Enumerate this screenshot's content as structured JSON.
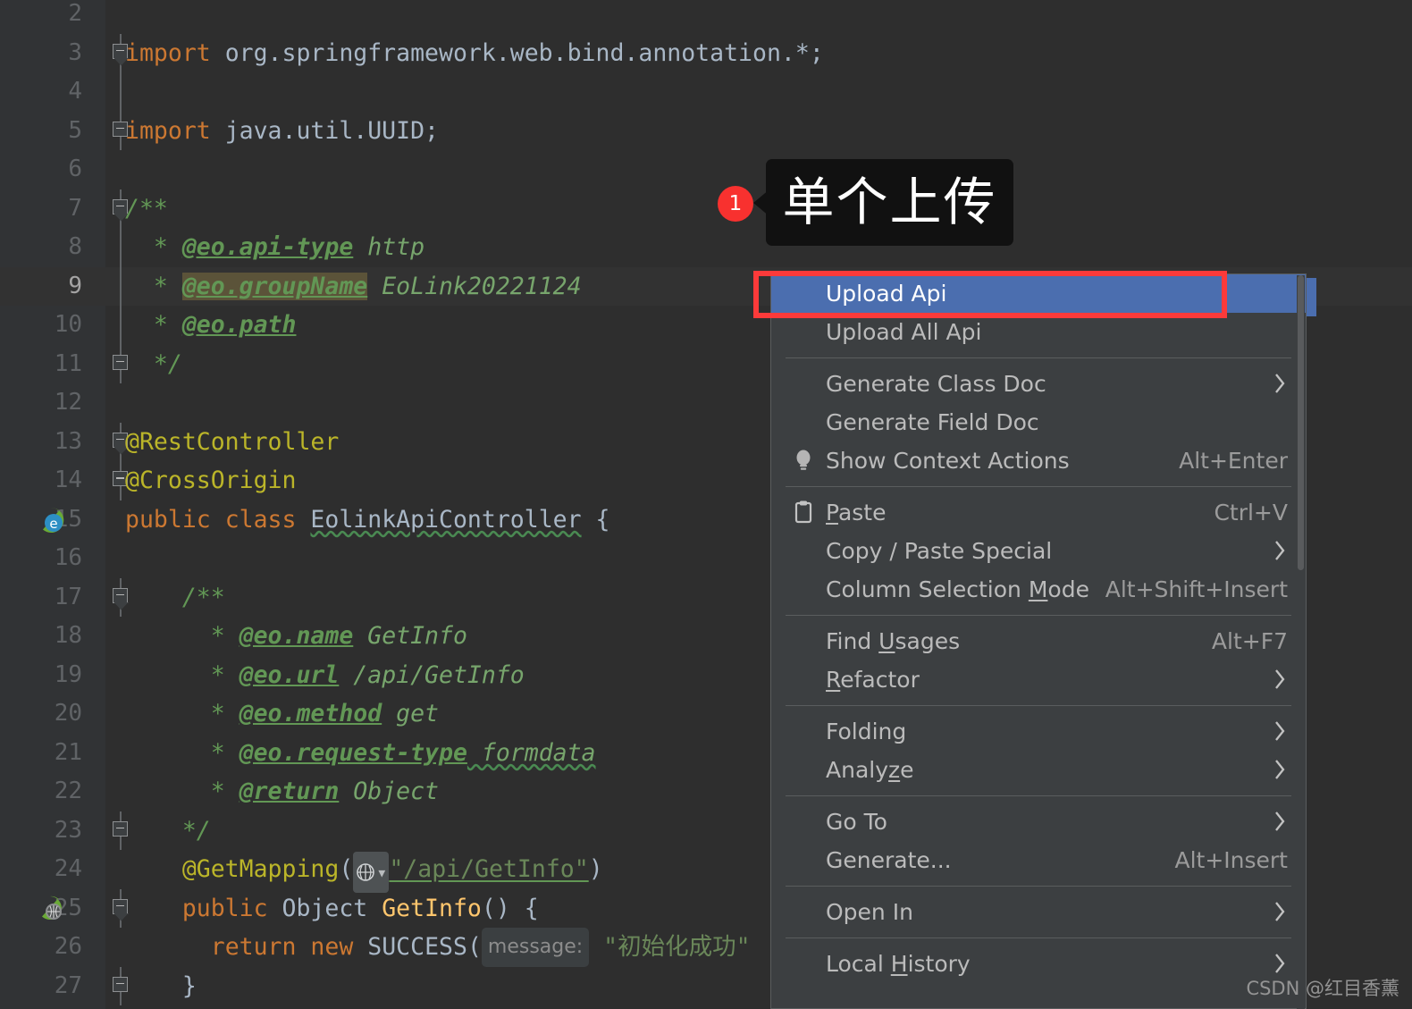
{
  "editor": {
    "lines": [
      {
        "num": "2",
        "tokens": [],
        "fold": "none"
      },
      {
        "num": "3",
        "fold": "start",
        "tokens": [
          {
            "t": "import ",
            "c": "kw"
          },
          {
            "t": "org.springframework.web.bind.annotation.*;",
            "c": "plain"
          }
        ]
      },
      {
        "num": "4",
        "fold": "stem",
        "tokens": []
      },
      {
        "num": "5",
        "fold": "end",
        "tokens": [
          {
            "t": "import ",
            "c": "kw"
          },
          {
            "t": "java.util.UUID;",
            "c": "plain"
          }
        ]
      },
      {
        "num": "6",
        "tokens": []
      },
      {
        "num": "7",
        "fold": "start",
        "tokens": [
          {
            "t": "/**",
            "c": "cmt"
          }
        ]
      },
      {
        "num": "8",
        "fold": "stem",
        "tokens": [
          {
            "t": "  * ",
            "c": "cmt"
          },
          {
            "t": "@eo.api-type",
            "c": "cmt-tag"
          },
          {
            "t": " http",
            "c": "cmt-val"
          }
        ]
      },
      {
        "num": "9",
        "fold": "stem",
        "current": true,
        "tokens": [
          {
            "t": "  * ",
            "c": "cmt"
          },
          {
            "t": "@eo.groupName",
            "c": "cmt-tag hl-tag"
          },
          {
            "t": " EoLink20221124",
            "c": "cmt-val"
          }
        ]
      },
      {
        "num": "10",
        "fold": "stem",
        "tokens": [
          {
            "t": "  * ",
            "c": "cmt"
          },
          {
            "t": "@eo.path",
            "c": "cmt-tag"
          }
        ]
      },
      {
        "num": "11",
        "fold": "end",
        "tokens": [
          {
            "t": "  */",
            "c": "cmt"
          }
        ]
      },
      {
        "num": "12",
        "tokens": []
      },
      {
        "num": "13",
        "fold": "start",
        "tokens": [
          {
            "t": "@RestController",
            "c": "ann"
          }
        ]
      },
      {
        "num": "14",
        "fold": "end",
        "tokens": [
          {
            "t": "@CrossOrigin",
            "c": "ann"
          }
        ]
      },
      {
        "num": "15",
        "gutterIcon": "eolink-blue-icon",
        "tokens": [
          {
            "t": "public ",
            "c": "kw"
          },
          {
            "t": "class ",
            "c": "kw"
          },
          {
            "t": "EolinkApiController",
            "c": "cls squiggle"
          },
          {
            "t": " {",
            "c": "plain"
          }
        ]
      },
      {
        "num": "16",
        "tokens": []
      },
      {
        "num": "17",
        "fold": "start2",
        "tokens": [
          {
            "t": "    /**",
            "c": "cmt"
          }
        ]
      },
      {
        "num": "18",
        "tokens": [
          {
            "t": "      * ",
            "c": "cmt"
          },
          {
            "t": "@eo.name",
            "c": "cmt-tag"
          },
          {
            "t": " GetInfo",
            "c": "cmt-val"
          }
        ]
      },
      {
        "num": "19",
        "tokens": [
          {
            "t": "      * ",
            "c": "cmt"
          },
          {
            "t": "@eo.url",
            "c": "cmt-tag"
          },
          {
            "t": " /api/GetInfo",
            "c": "cmt-val"
          }
        ]
      },
      {
        "num": "20",
        "tokens": [
          {
            "t": "      * ",
            "c": "cmt"
          },
          {
            "t": "@eo.method",
            "c": "cmt-tag"
          },
          {
            "t": " get",
            "c": "cmt-val"
          }
        ]
      },
      {
        "num": "21",
        "tokens": [
          {
            "t": "      * ",
            "c": "cmt"
          },
          {
            "t": "@eo.request-type",
            "c": "cmt-tag"
          },
          {
            "t": " formdata",
            "c": "cmt-val squiggle"
          }
        ]
      },
      {
        "num": "22",
        "tokens": [
          {
            "t": "      * ",
            "c": "cmt"
          },
          {
            "t": "@return",
            "c": "cmt-tag"
          },
          {
            "t": " Object",
            "c": "cmt-val"
          }
        ]
      },
      {
        "num": "23",
        "fold": "end2",
        "tokens": [
          {
            "t": "    */",
            "c": "cmt"
          }
        ]
      },
      {
        "num": "24",
        "special": "getmapping",
        "tokens": [
          {
            "t": "    @GetMapping",
            "c": "ann"
          },
          {
            "t": "(",
            "c": "plain"
          }
        ]
      },
      {
        "num": "25",
        "gutterIcon": "eolink-green-icon",
        "fold": "start2",
        "tokens": [
          {
            "t": "    public ",
            "c": "kw"
          },
          {
            "t": "Object ",
            "c": "plain"
          },
          {
            "t": "GetInfo",
            "c": "fn"
          },
          {
            "t": "() {",
            "c": "plain"
          }
        ]
      },
      {
        "num": "26",
        "special": "return",
        "tokens": []
      },
      {
        "num": "27",
        "fold": "end2",
        "tokens": [
          {
            "t": "    }",
            "c": "plain"
          }
        ]
      }
    ],
    "getmapping_rest": {
      "globe": "globe-icon",
      "chevron": "▾",
      "path": "\"/api/GetInfo\"",
      "close": ")"
    },
    "return_line": {
      "kw_return": "return ",
      "kw_new": "new ",
      "cls": "SUCCESS",
      "paren": "(",
      "hint": "message:",
      "str": "\"初始化成功\""
    }
  },
  "callout": {
    "badge": "1",
    "text": "单个上传"
  },
  "context_menu": {
    "items": [
      {
        "label": "Upload Api",
        "selected": true,
        "accel": "",
        "arrow": false,
        "icon": ""
      },
      {
        "label": "Upload All Api",
        "accel": "",
        "arrow": false,
        "icon": ""
      },
      {
        "separator": true
      },
      {
        "label": "Generate Class Doc",
        "accel": "",
        "arrow": true,
        "icon": ""
      },
      {
        "label": "Generate Field Doc",
        "accel": "",
        "arrow": false,
        "icon": ""
      },
      {
        "label": "Show Context Actions",
        "accel": "Alt+Enter",
        "arrow": false,
        "icon": "lightbulb-icon"
      },
      {
        "separator": true
      },
      {
        "label": "Paste",
        "mnemonic": "P",
        "accel": "Ctrl+V",
        "arrow": false,
        "icon": "clipboard-icon"
      },
      {
        "label": "Copy / Paste Special",
        "accel": "",
        "arrow": true,
        "icon": ""
      },
      {
        "label": "Column Selection Mode",
        "mnemonic": "M",
        "accel": "Alt+Shift+Insert",
        "arrow": false,
        "icon": ""
      },
      {
        "separator": true
      },
      {
        "label": "Find Usages",
        "mnemonic": "U",
        "accel": "Alt+F7",
        "arrow": false,
        "icon": ""
      },
      {
        "label": "Refactor",
        "mnemonic": "R",
        "accel": "",
        "arrow": true,
        "icon": ""
      },
      {
        "separator": true
      },
      {
        "label": "Folding",
        "accel": "",
        "arrow": true,
        "icon": ""
      },
      {
        "label": "Analyze",
        "mnemonic": "z",
        "accel": "",
        "arrow": true,
        "icon": ""
      },
      {
        "separator": true
      },
      {
        "label": "Go To",
        "accel": "",
        "arrow": true,
        "icon": ""
      },
      {
        "label": "Generate...",
        "accel": "Alt+Insert",
        "arrow": false,
        "icon": ""
      },
      {
        "separator": true
      },
      {
        "label": "Open In",
        "accel": "",
        "arrow": true,
        "icon": ""
      },
      {
        "separator": true
      },
      {
        "label": "Local History",
        "mnemonic": "H",
        "accel": "",
        "arrow": true,
        "icon": ""
      }
    ]
  },
  "watermark": "CSDN @红目香薰",
  "colors": {
    "editor_bg": "#2e2e2e",
    "gutter_bg": "#313335",
    "menu_bg": "#3c3f41",
    "selection_blue": "#4b6eaf",
    "highlight_red": "#fc3a3a",
    "badge_red": "#f8312f",
    "comment_green": "#629755",
    "keyword_orange": "#cc7832",
    "annotation_yellow": "#bbb529",
    "string_green": "#6a8759",
    "method_yellow": "#ffc66d",
    "plain_text": "#a9b7c6"
  }
}
